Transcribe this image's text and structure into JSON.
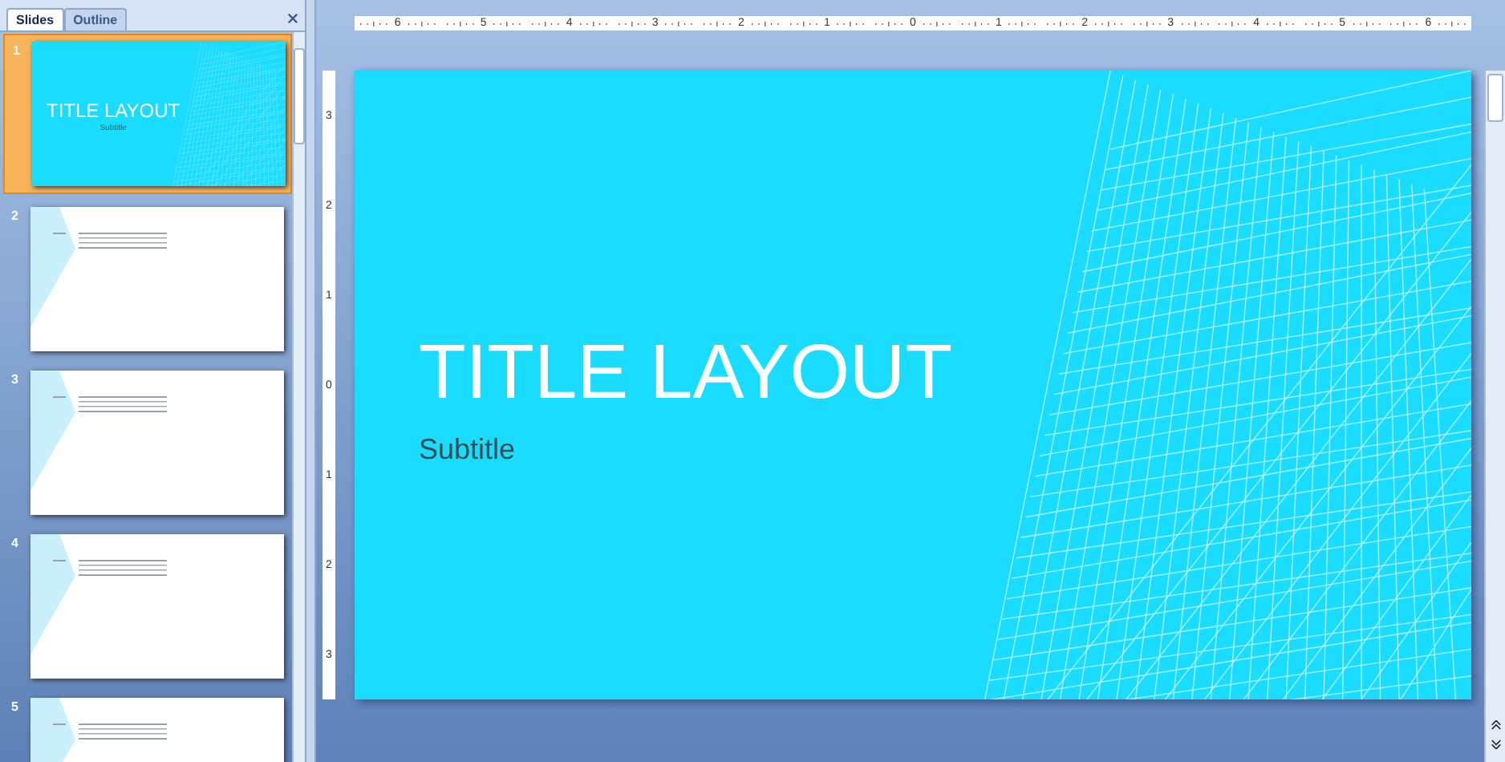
{
  "panel_tabs": [
    {
      "label": "Slides",
      "selected": true
    },
    {
      "label": "Outline",
      "selected": false
    }
  ],
  "slides": [
    {
      "number": "1",
      "selected": true,
      "kind": "title",
      "title": "TITLE LAYOUT",
      "subtitle": "Subtitle"
    },
    {
      "number": "2",
      "selected": false,
      "kind": "table"
    },
    {
      "number": "3",
      "selected": false,
      "kind": "table"
    },
    {
      "number": "4",
      "selected": false,
      "kind": "table"
    },
    {
      "number": "5",
      "selected": false,
      "kind": "table"
    }
  ],
  "horizontal_ruler": [
    "6",
    "5",
    "4",
    "3",
    "2",
    "1",
    "0",
    "1",
    "2",
    "3",
    "4",
    "5",
    "6"
  ],
  "vertical_ruler": [
    "3",
    "2",
    "1",
    "0",
    "1",
    "2",
    "3"
  ],
  "current_slide": {
    "title": "TITLE LAYOUT",
    "subtitle": "Subtitle"
  }
}
